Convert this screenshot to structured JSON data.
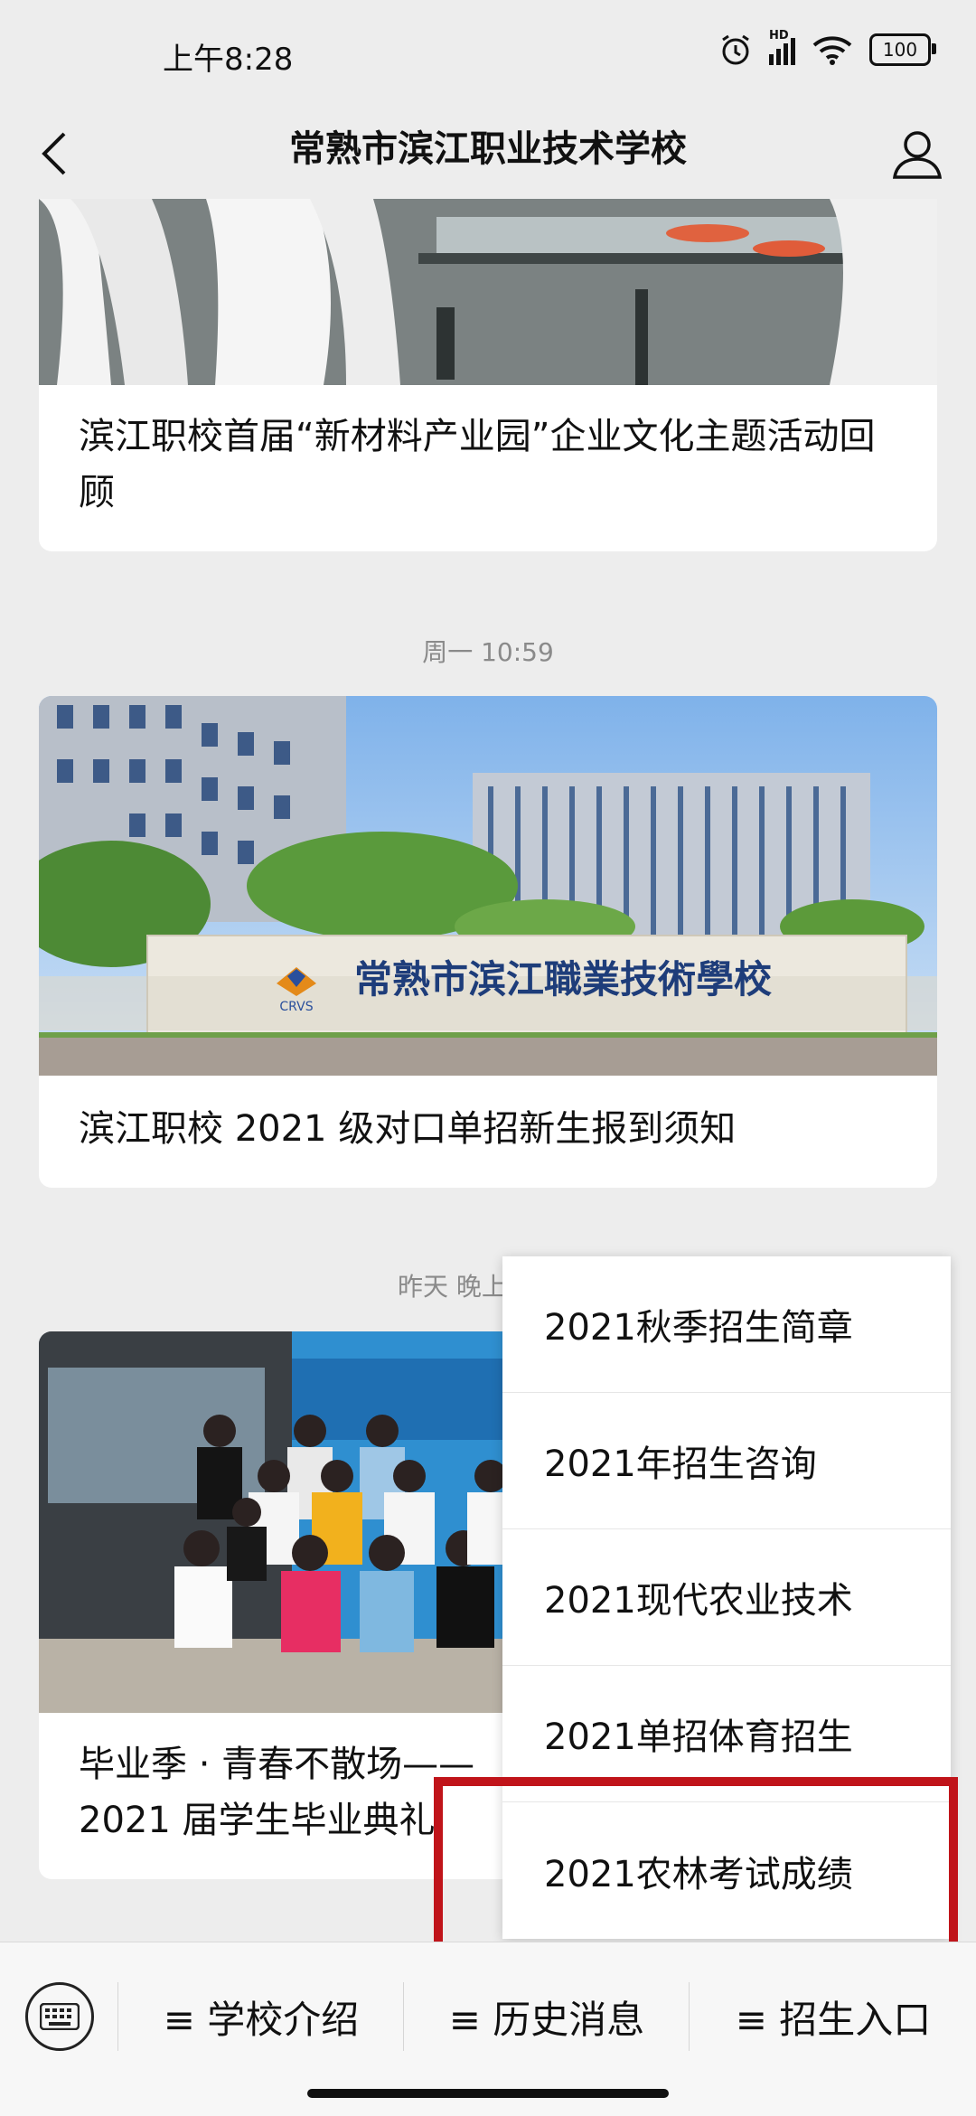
{
  "status_bar": {
    "time": "上午8:28",
    "net_label": "HD",
    "battery": "100"
  },
  "nav": {
    "title": "常熟市滨江职业技术学校"
  },
  "articles": [
    {
      "caption": "滨江职校首届“新材料产业园”企业文化主题活动回顾"
    },
    {
      "timestamp": "周一 10:59",
      "caption": "滨江职校 2021 级对口单招新生报到须知",
      "sign_text": "常熟市滨江職業技術學校",
      "logo_text": "CRVS"
    },
    {
      "timestamp": "昨天 晚上",
      "caption": "毕业季 · 青春不散场—— 2021 届学生毕业典礼"
    }
  ],
  "popup_menu": {
    "items": [
      "2021秋季招生简章",
      "2021年招生咨询",
      "2021现代农业技术",
      "2021单招体育招生",
      "2021农林考试成绩"
    ]
  },
  "bottom_bar": {
    "tabs": [
      "≡ 学校介绍",
      "≡ 历史消息",
      "≡ 招生入口"
    ]
  }
}
